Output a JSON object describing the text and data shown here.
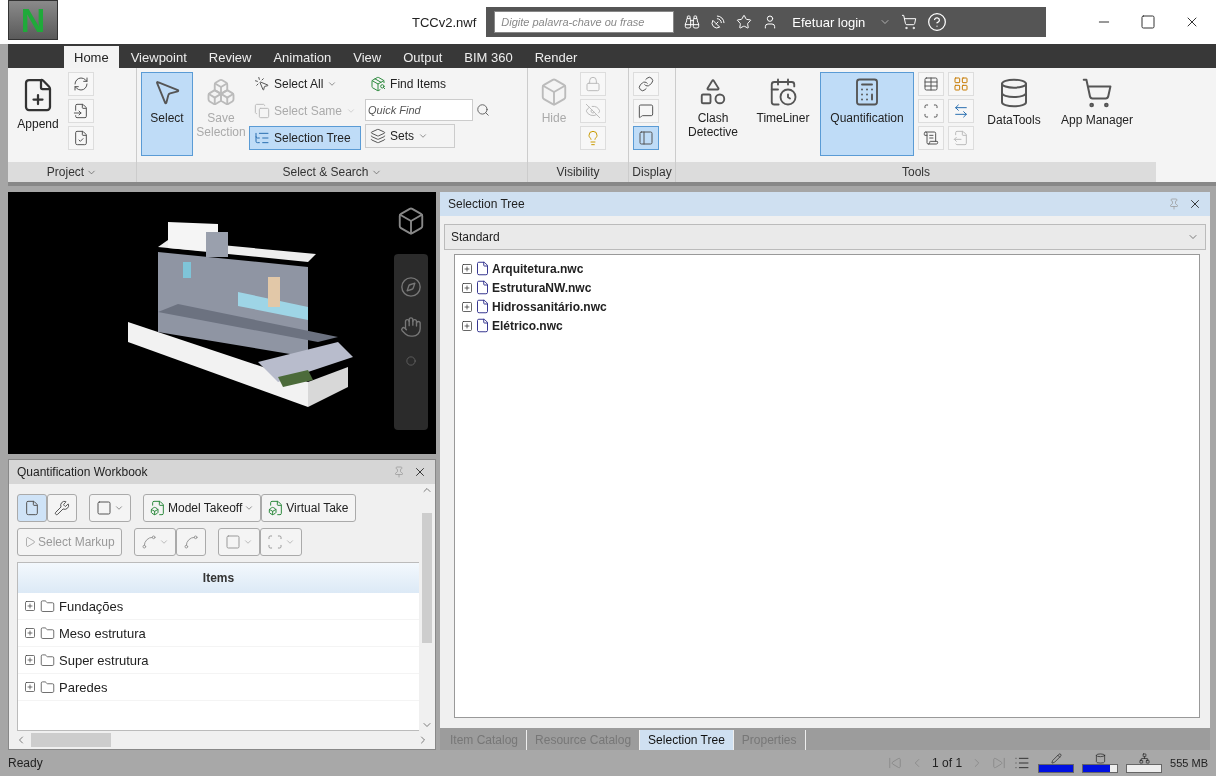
{
  "app": {
    "logo": "N",
    "title": "TCCv2.nwf"
  },
  "search": {
    "placeholder": "Digite palavra-chave ou frase"
  },
  "login": {
    "label": "Efetuar login"
  },
  "ribbon_tabs": [
    {
      "label": "Home",
      "selected": true
    },
    {
      "label": "Viewpoint",
      "selected": false
    },
    {
      "label": "Review",
      "selected": false
    },
    {
      "label": "Animation",
      "selected": false
    },
    {
      "label": "View",
      "selected": false
    },
    {
      "label": "Output",
      "selected": false
    },
    {
      "label": "BIM 360",
      "selected": false
    },
    {
      "label": "Render",
      "selected": false
    }
  ],
  "ribbon": {
    "project": {
      "label": "Project",
      "append": {
        "label": "Append"
      }
    },
    "select_search": {
      "label": "Select & Search",
      "select": {
        "label": "Select",
        "selected": true
      },
      "save_selection": {
        "label": "Save Selection",
        "disabled": true
      },
      "select_all": {
        "label": "Select All",
        "disabled": false
      },
      "select_same": {
        "label": "Select Same",
        "disabled": true
      },
      "selection_tree": {
        "label": "Selection Tree",
        "selected": true
      },
      "find_items": {
        "label": "Find Items"
      },
      "quick_find": {
        "placeholder": "Quick Find"
      },
      "sets": {
        "label": "Sets"
      }
    },
    "visibility": {
      "label": "Visibility",
      "hide": {
        "label": "Hide",
        "disabled": true
      }
    },
    "display": {
      "label": "Display",
      "buttons": [
        {
          "selected": false
        },
        {
          "selected": false
        },
        {
          "selected": true
        }
      ]
    },
    "tools": {
      "label": "Tools",
      "buttons": [
        {
          "label": "Clash Detective",
          "selected": false
        },
        {
          "label": "TimeLiner",
          "selected": false
        },
        {
          "label": "Quantification",
          "selected": true
        }
      ]
    },
    "extras": [
      {
        "label": "DataTools"
      },
      {
        "label": "App Manager"
      }
    ]
  },
  "workbook": {
    "title": "Quantification Workbook",
    "mode_buttons": [
      {
        "selected": true
      },
      {
        "selected": false
      }
    ],
    "model_takeoff": {
      "label": "Model Takeoff"
    },
    "virtual_takeoff": {
      "label": "Virtual Take"
    },
    "select_markup": {
      "label": "Select Markup",
      "disabled": true
    },
    "column": "Items",
    "items": [
      {
        "label": "Fundações"
      },
      {
        "label": "Meso estrutura"
      },
      {
        "label": "Super estrutura"
      },
      {
        "label": "Paredes"
      }
    ]
  },
  "selection_tree": {
    "title": "Selection Tree",
    "mode": "Standard",
    "items": [
      {
        "label": "Arquitetura.nwc"
      },
      {
        "label": "EstruturaNW.nwc"
      },
      {
        "label": "Hidrossanitário.nwc"
      },
      {
        "label": "Elétrico.nwc"
      }
    ]
  },
  "bottom_tabs": [
    {
      "label": "Item Catalog",
      "selected": false
    },
    {
      "label": "Resource Catalog",
      "selected": false
    },
    {
      "label": "Selection Tree",
      "selected": true
    },
    {
      "label": "Properties",
      "selected": false
    }
  ],
  "status_bar": {
    "text": "Ready",
    "page": "1 of 1",
    "meters": [
      {
        "level": 1
      },
      {
        "level": 0.8
      },
      {
        "level": 0
      }
    ],
    "memory": "555 MB"
  }
}
